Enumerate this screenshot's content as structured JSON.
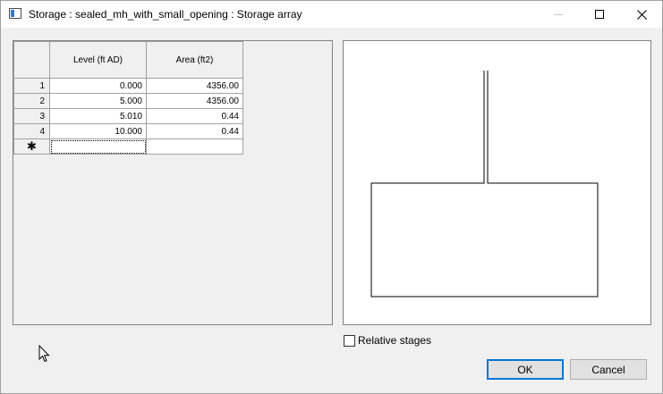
{
  "window": {
    "title": "Storage : sealed_mh_with_small_opening : Storage array"
  },
  "table": {
    "headers": [
      "Level (ft AD)",
      "Area (ft2)"
    ],
    "rows": [
      {
        "num": "1",
        "level": "0.000",
        "area": "4356.00"
      },
      {
        "num": "2",
        "level": "5.000",
        "area": "4356.00"
      },
      {
        "num": "3",
        "level": "5.010",
        "area": "0.44"
      },
      {
        "num": "4",
        "level": "10.000",
        "area": "0.44"
      }
    ],
    "new_row_marker": "✱"
  },
  "options": {
    "relative_stages_label": "Relative stages",
    "relative_stages_checked": false
  },
  "buttons": {
    "ok": "OK",
    "cancel": "Cancel"
  },
  "icons": [
    "app-icon",
    "minimize-icon",
    "maximize-icon",
    "close-icon",
    "mouse-pointer-icon"
  ]
}
